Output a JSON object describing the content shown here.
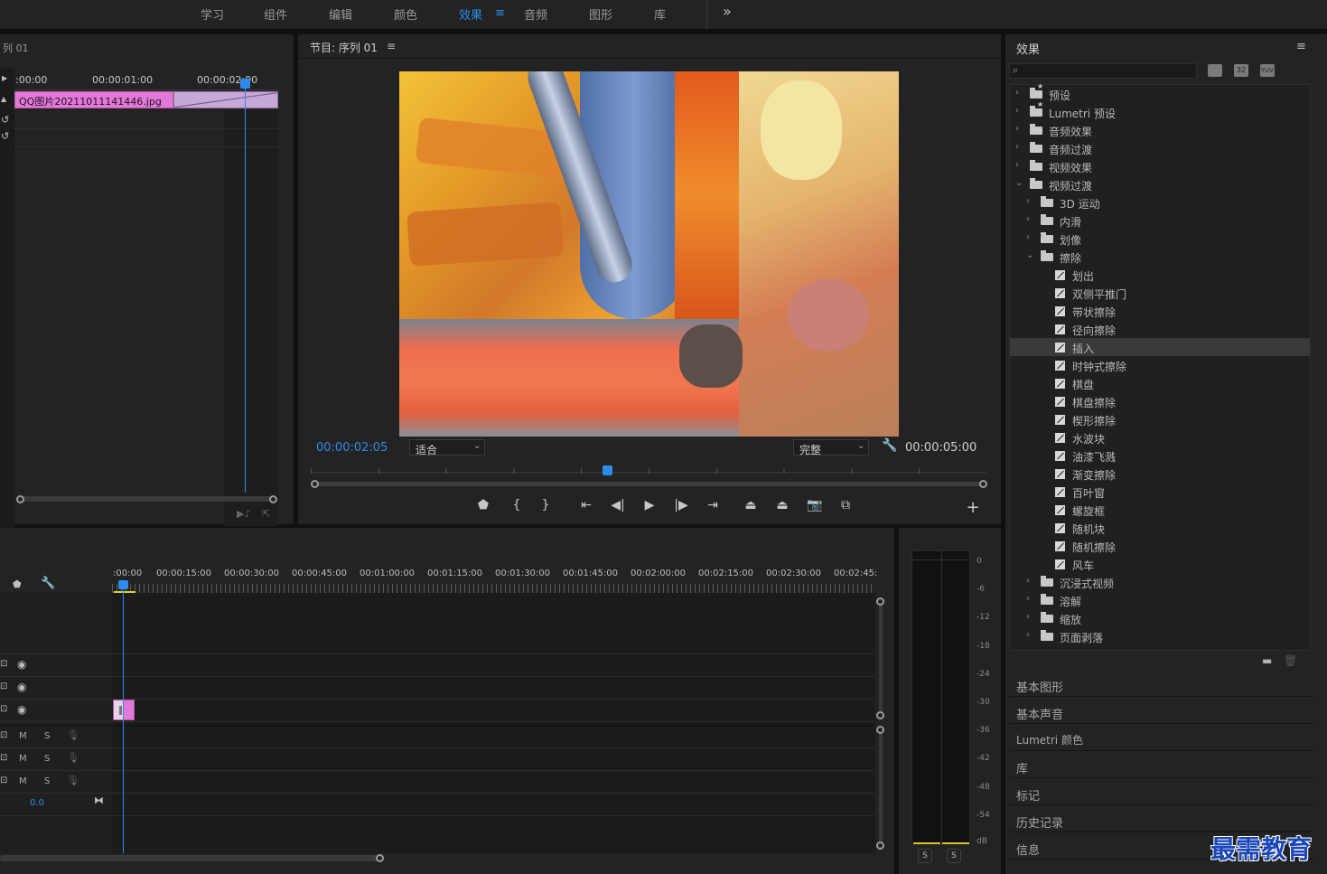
{
  "workspace_tabs": [
    "学习",
    "组件",
    "编辑",
    "颜色",
    "效果",
    "音频",
    "图形",
    "库"
  ],
  "workspace_active": "效果",
  "overflow_glyph": "»",
  "source_panel": {
    "title": "列 01",
    "time_labels": [
      ":00:00",
      "00:00:01:00",
      "00:00:02:00"
    ],
    "clip_name": "QQ图片20211011141446.jpg"
  },
  "program": {
    "title": "节目: 序列 01",
    "current_time": "00:00:02:05",
    "zoom_select": "适合",
    "quality_select": "完整",
    "duration": "00:00:05:00"
  },
  "effects": {
    "title": "效果",
    "search_placeholder": "",
    "badges": [
      "32",
      "YUV"
    ],
    "tree": [
      {
        "label": "预设",
        "kind": "preset",
        "level": 0,
        "chev": "›"
      },
      {
        "label": "Lumetri 预设",
        "kind": "preset",
        "level": 0,
        "chev": "›"
      },
      {
        "label": "音频效果",
        "kind": "folder",
        "level": 0,
        "chev": "›"
      },
      {
        "label": "音频过渡",
        "kind": "folder",
        "level": 0,
        "chev": "›"
      },
      {
        "label": "视频效果",
        "kind": "folder",
        "level": 0,
        "chev": "›"
      },
      {
        "label": "视频过渡",
        "kind": "folder",
        "level": 0,
        "chev": "⌄"
      },
      {
        "label": "3D 运动",
        "kind": "folder",
        "level": 1,
        "chev": "›"
      },
      {
        "label": "内滑",
        "kind": "folder",
        "level": 1,
        "chev": "›"
      },
      {
        "label": "划像",
        "kind": "folder",
        "level": 1,
        "chev": "›"
      },
      {
        "label": "擦除",
        "kind": "folder",
        "level": 1,
        "chev": "⌄"
      },
      {
        "label": "划出",
        "kind": "effect",
        "level": 2
      },
      {
        "label": "双侧平推门",
        "kind": "effect",
        "level": 2
      },
      {
        "label": "带状擦除",
        "kind": "effect",
        "level": 2
      },
      {
        "label": "径向擦除",
        "kind": "effect",
        "level": 2
      },
      {
        "label": "插入",
        "kind": "effect",
        "level": 2,
        "selected": true
      },
      {
        "label": "时钟式擦除",
        "kind": "effect",
        "level": 2
      },
      {
        "label": "棋盘",
        "kind": "effect",
        "level": 2
      },
      {
        "label": "棋盘擦除",
        "kind": "effect",
        "level": 2
      },
      {
        "label": "楔形擦除",
        "kind": "effect",
        "level": 2
      },
      {
        "label": "水波块",
        "kind": "effect",
        "level": 2
      },
      {
        "label": "油漆飞溅",
        "kind": "effect",
        "level": 2
      },
      {
        "label": "渐变擦除",
        "kind": "effect",
        "level": 2
      },
      {
        "label": "百叶窗",
        "kind": "effect",
        "level": 2
      },
      {
        "label": "螺旋框",
        "kind": "effect",
        "level": 2
      },
      {
        "label": "随机块",
        "kind": "effect",
        "level": 2
      },
      {
        "label": "随机擦除",
        "kind": "effect",
        "level": 2
      },
      {
        "label": "风车",
        "kind": "effect",
        "level": 2
      },
      {
        "label": "沉浸式视频",
        "kind": "folder",
        "level": 1,
        "chev": "›"
      },
      {
        "label": "溶解",
        "kind": "folder",
        "level": 1,
        "chev": "›"
      },
      {
        "label": "缩放",
        "kind": "folder",
        "level": 1,
        "chev": "›"
      },
      {
        "label": "页面剥落",
        "kind": "folder",
        "level": 1,
        "chev": "›"
      }
    ]
  },
  "side_panels": [
    "基本图形",
    "基本声音",
    "Lumetri 颜色",
    "库",
    "标记",
    "历史记录",
    "信息"
  ],
  "timeline": {
    "ruler": [
      ":00:00",
      "00:00:15:00",
      "00:00:30:00",
      "00:00:45:00",
      "00:01:00:00",
      "00:01:15:00",
      "00:01:30:00",
      "00:01:45:00",
      "00:02:00:00",
      "00:02:15:00",
      "00:02:30:00",
      "00:02:45:"
    ],
    "audio_track_m": "M",
    "audio_track_s": "S",
    "master_value": "0.0"
  },
  "meter": {
    "scale": [
      "0",
      "-6",
      "-12",
      "-18",
      "-24",
      "-30",
      "-36",
      "-42",
      "-48",
      "-54",
      "dB"
    ],
    "solo_left": "S",
    "solo_right": "S"
  },
  "watermark": "最需教育",
  "colors": {
    "accent": "#2d8ceb",
    "clip_pink": "#e07ad6",
    "clip_lavender": "#c9a7d8",
    "panel": "#232323"
  }
}
